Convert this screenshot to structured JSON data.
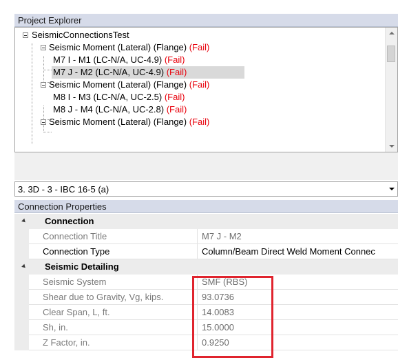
{
  "project_explorer": {
    "title": "Project Explorer",
    "tree": [
      {
        "label": "SeismicConnectionsTest",
        "status": ""
      },
      {
        "label": "Seismic Moment (Lateral) (Flange)",
        "status": "(Fail)"
      },
      {
        "label": "M7 I - M1 (LC-N/A, UC-4.9)",
        "status": "(Fail)"
      },
      {
        "label": "M7 J - M2 (LC-N/A, UC-4.9)",
        "status": "(Fail)",
        "selected": true
      },
      {
        "label": "Seismic Moment (Lateral) (Flange)",
        "status": "(Fail)"
      },
      {
        "label": "M8 I - M3 (LC-N/A, UC-2.5)",
        "status": "(Fail)"
      },
      {
        "label": "M8 J - M4 (LC-N/A, UC-2.8)",
        "status": "(Fail)"
      },
      {
        "label": "Seismic Moment (Lateral) (Flange)",
        "status": "(Fail)"
      }
    ]
  },
  "combo": {
    "value": "3. 3D - 3 - IBC 16-5 (a)"
  },
  "connection_properties": {
    "title": "Connection Properties",
    "categories": [
      {
        "name": "Connection",
        "rows": [
          {
            "name": "Connection Title",
            "value": "M7 J - M2"
          },
          {
            "name": "Connection Type",
            "value": "Column/Beam Direct Weld Moment Connec"
          }
        ]
      },
      {
        "name": "Seismic Detailing",
        "rows": [
          {
            "name": "Seismic System",
            "value": "SMF (RBS)"
          },
          {
            "name": "Shear due to Gravity, Vg, kips.",
            "value": "93.0736"
          },
          {
            "name": "Clear Span, L, ft.",
            "value": "14.0083"
          },
          {
            "name": "Sh, in.",
            "value": "15.0000"
          },
          {
            "name": "Z Factor, in.",
            "value": "0.9250"
          }
        ]
      }
    ]
  },
  "colors": {
    "fail": "#e8000b",
    "highlight": "#e0242e",
    "header": "#d6dbe9"
  }
}
